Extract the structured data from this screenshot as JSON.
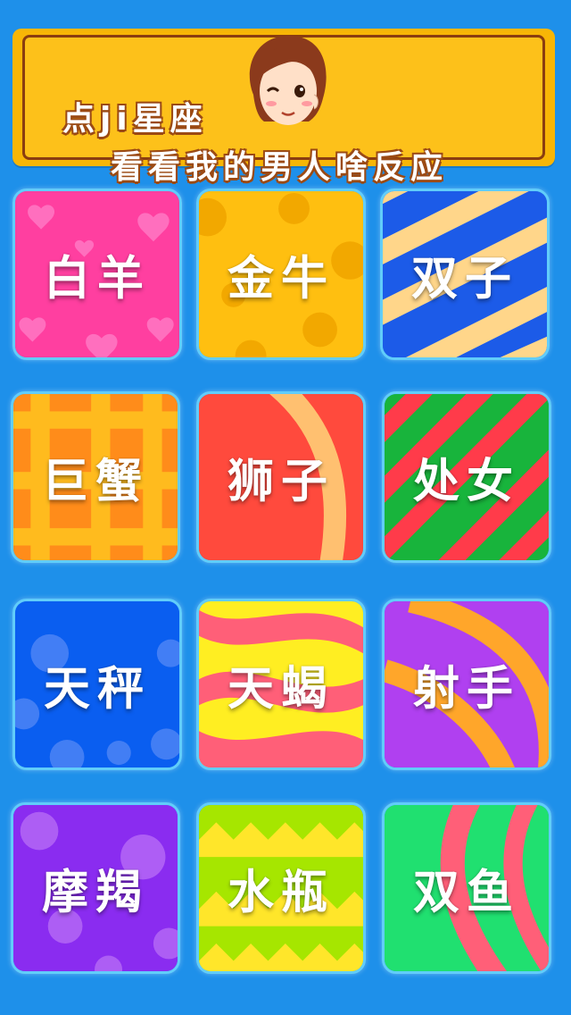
{
  "banner": {
    "line1": "点ji星座",
    "line2": "看看我的男人啥反应"
  },
  "signs": [
    {
      "label": "白羊",
      "color": "#ff3fa0"
    },
    {
      "label": "金牛",
      "color": "#ffbf10"
    },
    {
      "label": "双子",
      "color": "#1c5be8"
    },
    {
      "label": "巨蟹",
      "color": "#ff8c1a"
    },
    {
      "label": "狮子",
      "color": "#ff4a3d"
    },
    {
      "label": "处女",
      "color": "#18b43c"
    },
    {
      "label": "天秤",
      "color": "#0a5ef0"
    },
    {
      "label": "天蝎",
      "color": "#ff5f78"
    },
    {
      "label": "射手",
      "color": "#b040f0"
    },
    {
      "label": "摩羯",
      "color": "#8a2cf0"
    },
    {
      "label": "水瓶",
      "color": "#a6e600"
    },
    {
      "label": "双鱼",
      "color": "#20e070"
    }
  ]
}
